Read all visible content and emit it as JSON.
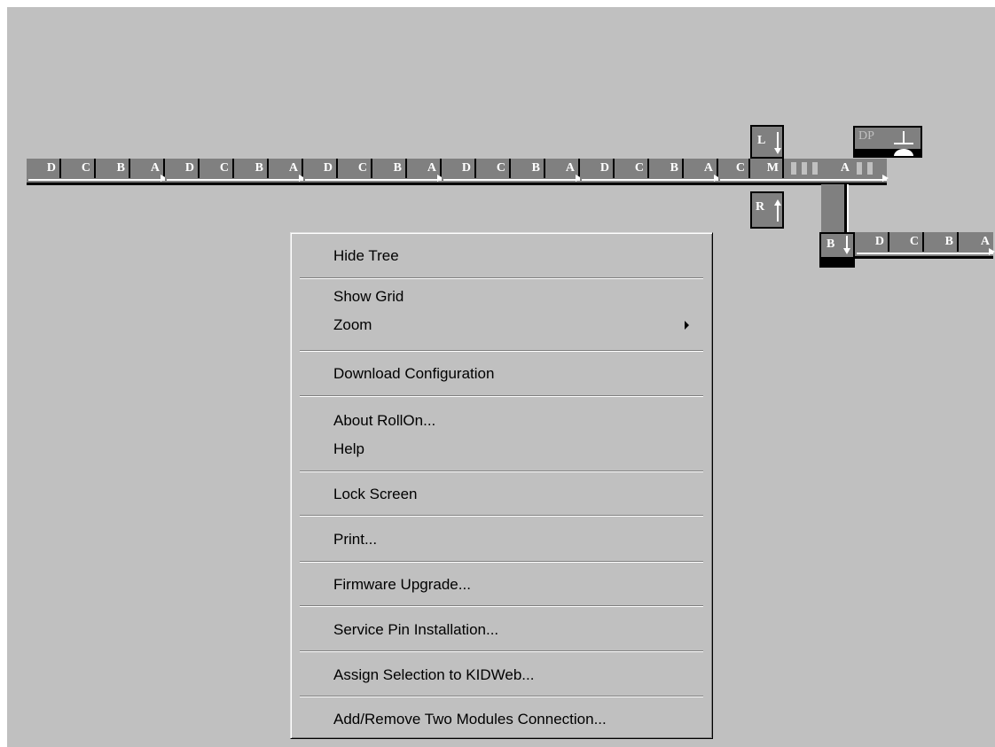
{
  "conveyor": {
    "zones": [
      {
        "letters": [
          "D",
          "C",
          "B",
          "A"
        ]
      },
      {
        "letters": [
          "D",
          "C",
          "B",
          "A"
        ]
      },
      {
        "letters": [
          "D",
          "C",
          "B",
          "A"
        ]
      },
      {
        "letters": [
          "D",
          "C",
          "B",
          "A"
        ]
      },
      {
        "letters": [
          "D",
          "C",
          "B",
          "A"
        ]
      }
    ],
    "merge": {
      "c": "C",
      "m": "M",
      "a": "A",
      "l": "L",
      "r": "R"
    },
    "dp": {
      "label": "DP"
    },
    "branch": {
      "b": "B",
      "letters": [
        "D",
        "C",
        "B",
        "A"
      ]
    }
  },
  "context_menu": {
    "items": [
      {
        "label": "Hide Tree"
      },
      {
        "label": "Show Grid"
      },
      {
        "label": "Zoom",
        "submenu": true
      },
      {
        "label": "Download Configuration"
      },
      {
        "label": "About RollOn..."
      },
      {
        "label": "Help"
      },
      {
        "label": "Lock Screen"
      },
      {
        "label": "Print..."
      },
      {
        "label": "Firmware Upgrade..."
      },
      {
        "label": "Service Pin Installation..."
      },
      {
        "label": "Assign Selection to KIDWeb..."
      },
      {
        "label": "Add/Remove Two Modules Connection..."
      }
    ]
  }
}
